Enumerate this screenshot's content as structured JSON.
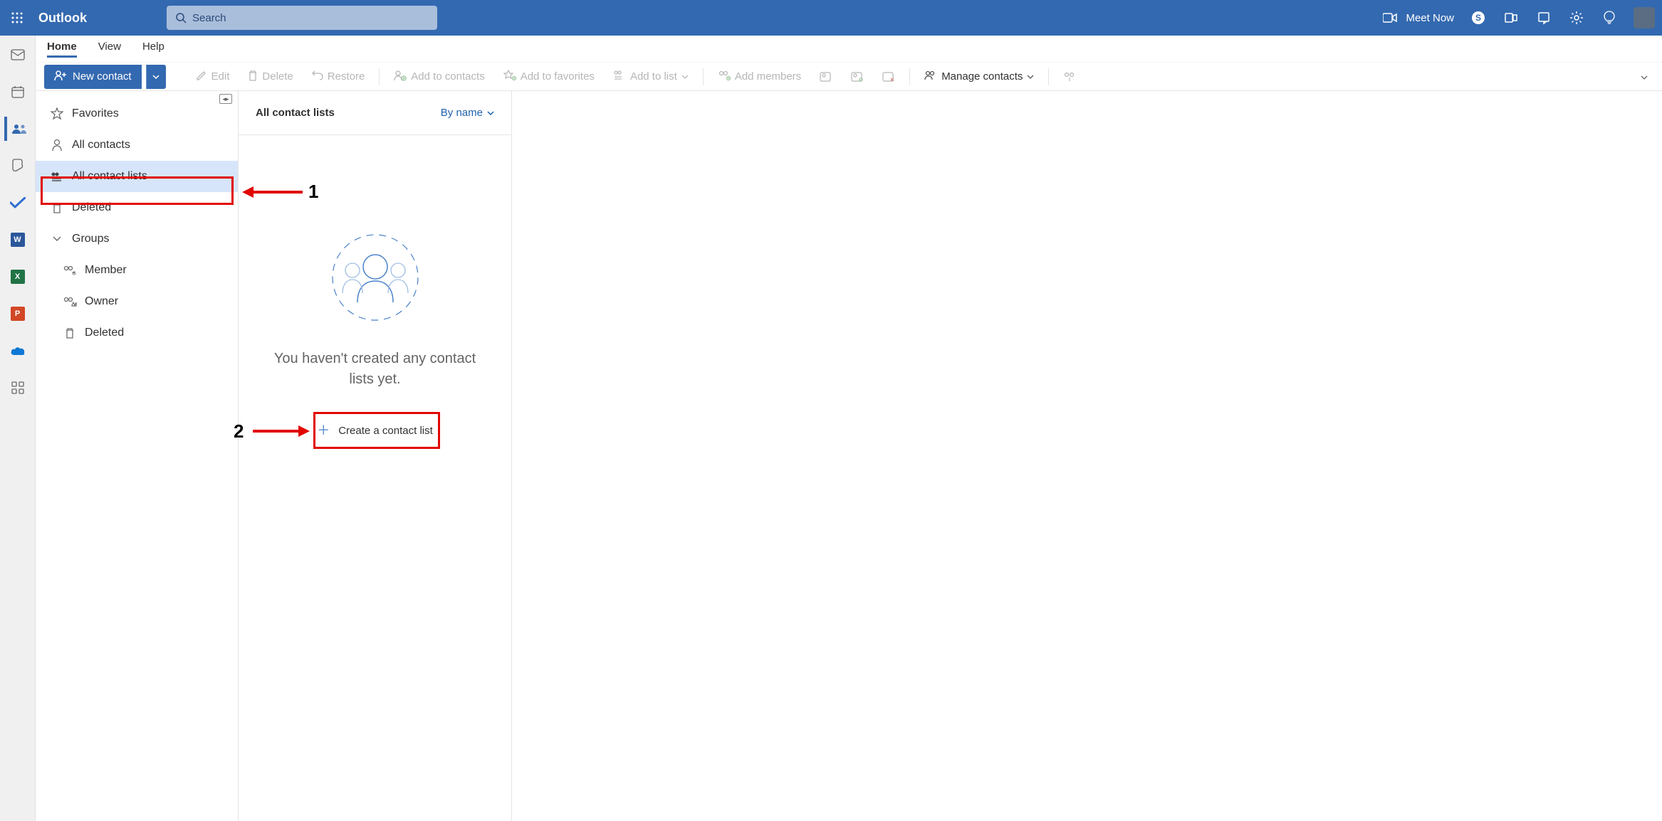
{
  "header": {
    "app_name": "Outlook",
    "search_placeholder": "Search",
    "meet_now": "Meet Now"
  },
  "tabs": {
    "items": [
      "Home",
      "View",
      "Help"
    ],
    "active": 0
  },
  "toolbar": {
    "new_contact": "New contact",
    "edit": "Edit",
    "delete": "Delete",
    "restore": "Restore",
    "add_to_contacts": "Add to contacts",
    "add_to_favorites": "Add to favorites",
    "add_to_list": "Add to list",
    "add_members": "Add members",
    "manage_contacts": "Manage contacts"
  },
  "nav": {
    "favorites": "Favorites",
    "all_contacts": "All contacts",
    "all_contact_lists": "All contact lists",
    "deleted": "Deleted",
    "groups": "Groups",
    "member": "Member",
    "owner": "Owner",
    "groups_deleted": "Deleted"
  },
  "listpane": {
    "title": "All contact lists",
    "sort": "By name",
    "empty_msg": "You haven't created any contact lists yet.",
    "create_label": "Create a contact list"
  },
  "annotations": {
    "num1": "1",
    "num2": "2"
  }
}
